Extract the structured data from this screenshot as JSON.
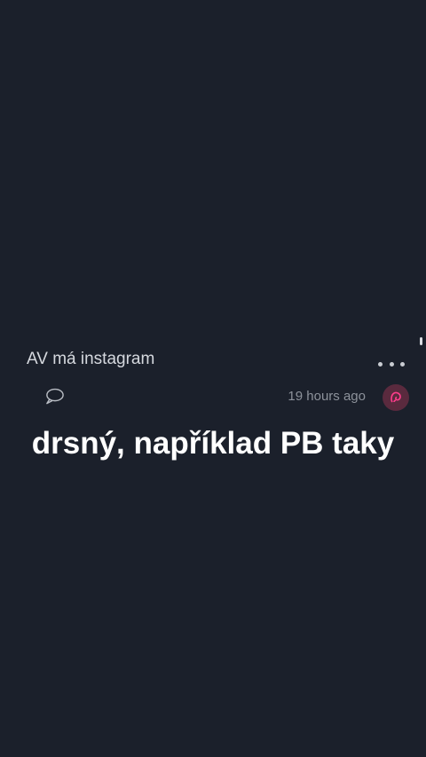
{
  "post": {
    "title": "AV má instagram",
    "timestamp": "19 hours ago",
    "body": "drsný, například PB taky",
    "avatar_color": "#5a2a3e",
    "avatar_accent": "#ff3d8c"
  },
  "icons": {
    "more": "more-horizontal-icon",
    "comment": "speech-bubble-icon",
    "avatar": "user-avatar-icon"
  }
}
